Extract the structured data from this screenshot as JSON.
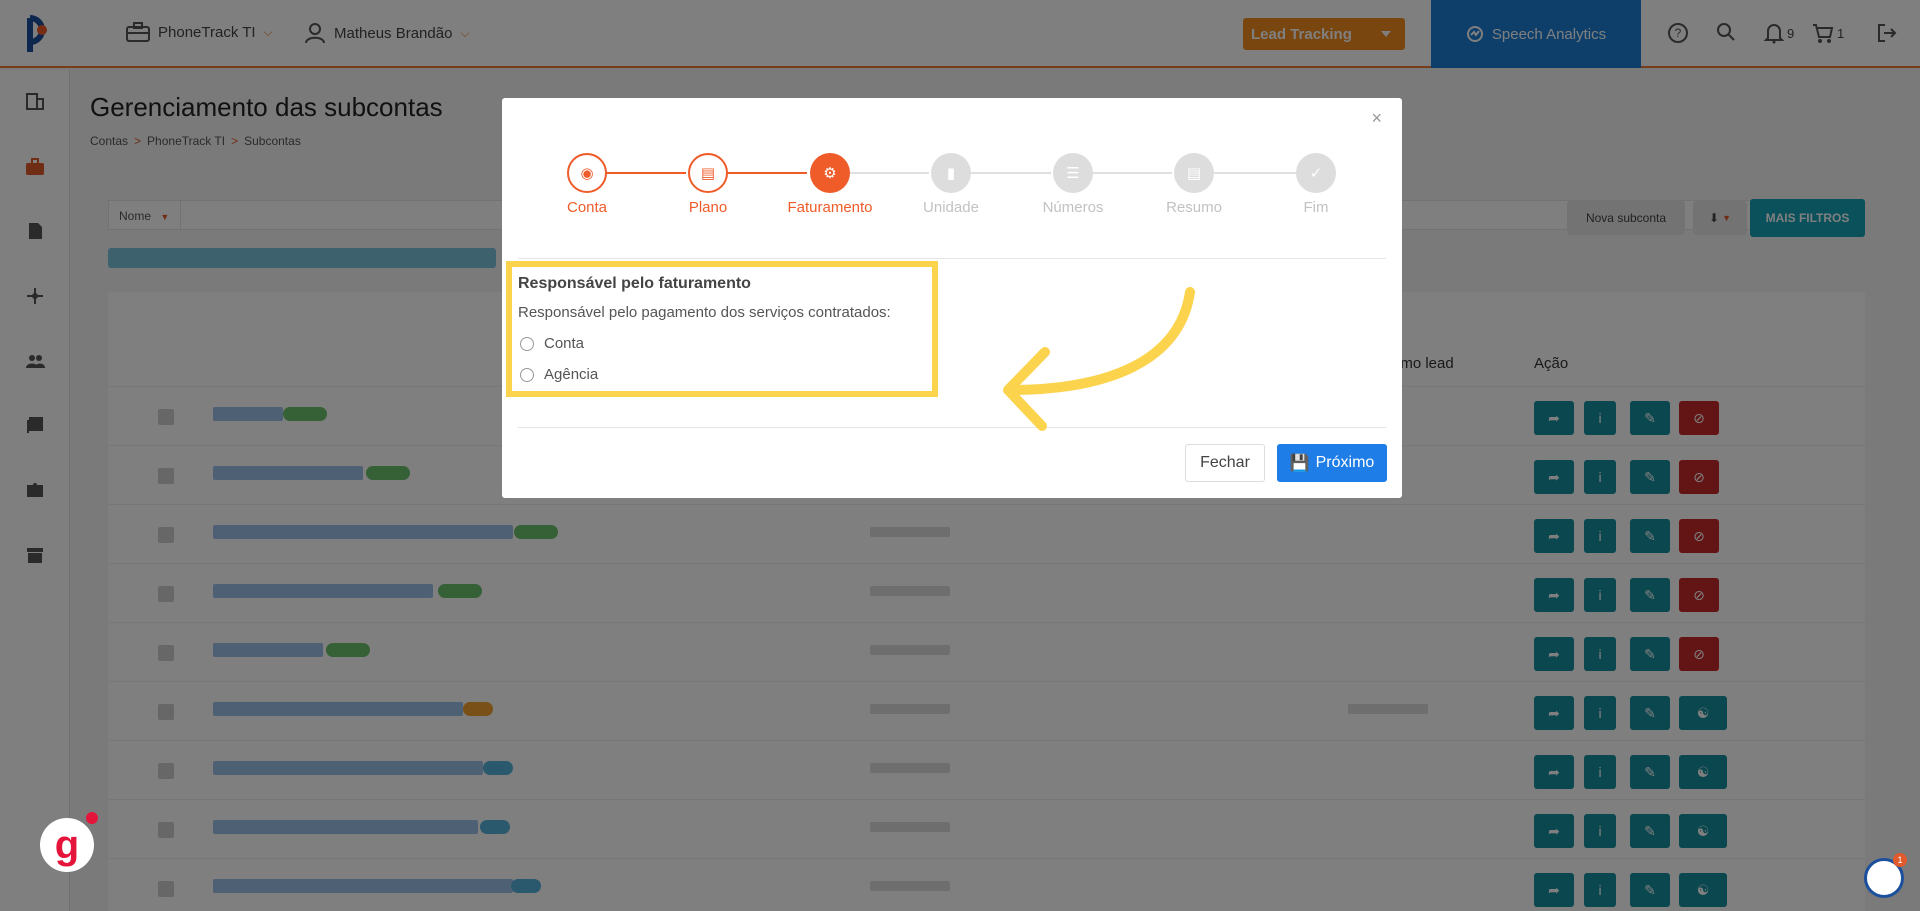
{
  "topbar": {
    "account_name": "PhoneTrack TI",
    "user_name": "Matheus Brandão",
    "lead_tracking_label": "Lead Tracking",
    "speech_analytics_label": "Speech Analytics",
    "notifications_count": "9",
    "cart_count": "1",
    "accent_color": "#f07a2c"
  },
  "page": {
    "title": "Gerenciamento das subcontas",
    "breadcrumb": [
      "Contas",
      "PhoneTrack TI",
      "Subcontas"
    ],
    "filter_field": "Nome",
    "nova_subconta_label": "Nova subconta",
    "mais_filtros_label": "MAIS FILTROS",
    "columns": {
      "last_lead": "imo lead",
      "action": "Ação"
    }
  },
  "modal": {
    "steps": [
      {
        "label": "Conta",
        "state": "done",
        "icon": "briefcase-icon"
      },
      {
        "label": "Plano",
        "state": "done",
        "icon": "cart-icon"
      },
      {
        "label": "Faturamento",
        "state": "active",
        "icon": "gears-icon"
      },
      {
        "label": "Unidade",
        "state": "todo",
        "icon": "building-icon"
      },
      {
        "label": "Números",
        "state": "todo",
        "icon": "list-icon"
      },
      {
        "label": "Resumo",
        "state": "todo",
        "icon": "document-icon"
      },
      {
        "label": "Fim",
        "state": "todo",
        "icon": "check-icon"
      }
    ],
    "section_title": "Responsável pelo faturamento",
    "section_desc": "Responsável pelo pagamento dos serviços contratados:",
    "options": [
      "Conta",
      "Agência"
    ],
    "close_label": "Fechar",
    "next_label": "Próximo"
  }
}
